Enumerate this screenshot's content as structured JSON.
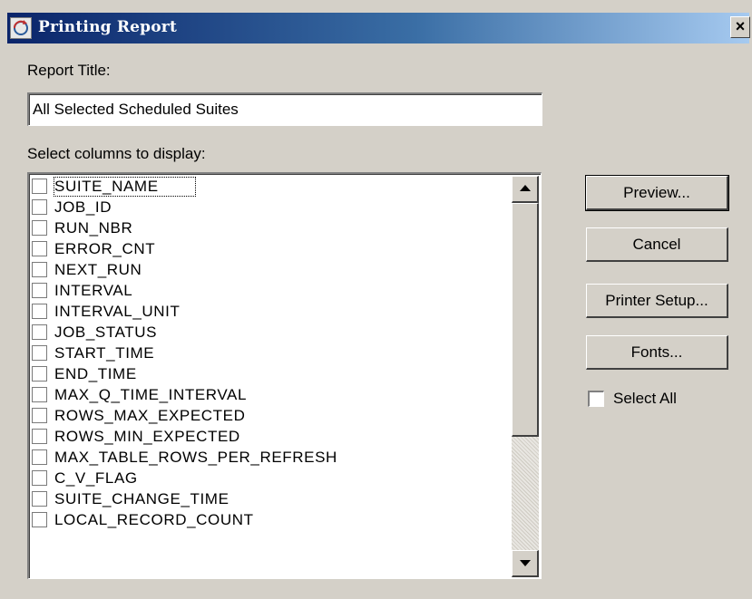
{
  "window": {
    "title": "Printing Report",
    "close_label": "×"
  },
  "report_title": {
    "label": "Report Title:",
    "value": "All Selected Scheduled Suites"
  },
  "columns": {
    "label": "Select columns to display:",
    "items": [
      "SUITE_NAME",
      "JOB_ID",
      "RUN_NBR",
      "ERROR_CNT",
      "NEXT_RUN",
      "INTERVAL",
      "INTERVAL_UNIT",
      "JOB_STATUS",
      "START_TIME",
      "END_TIME",
      "MAX_Q_TIME_INTERVAL",
      "ROWS_MAX_EXPECTED",
      "ROWS_MIN_EXPECTED",
      "MAX_TABLE_ROWS_PER_REFRESH",
      "C_V_FLAG",
      "SUITE_CHANGE_TIME",
      "LOCAL_RECORD_COUNT"
    ]
  },
  "buttons": {
    "preview": "Preview...",
    "cancel": "Cancel",
    "printer_setup": "Printer Setup...",
    "fonts": "Fonts..."
  },
  "select_all": {
    "label": "Select All",
    "checked": false
  }
}
